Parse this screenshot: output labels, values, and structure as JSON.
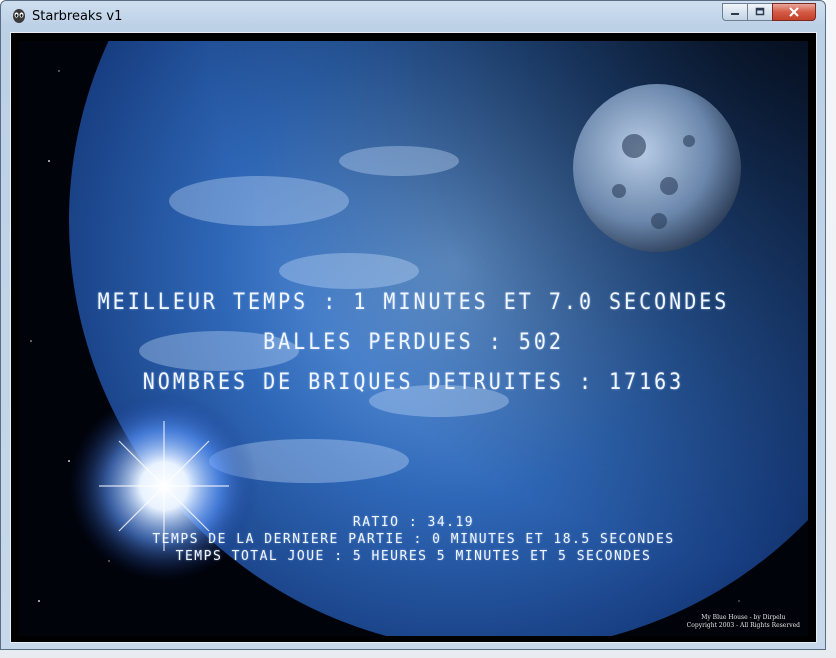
{
  "window": {
    "title": "Starbreaks v1",
    "icon": "alien-icon",
    "controls": [
      "minimize-icon",
      "maximize-icon",
      "close-icon"
    ]
  },
  "stats": {
    "best_time": "MEILLEUR TEMPS : 1 MINUTES ET 7.0 SECONDES",
    "balls_lost": "BALLES PERDUES : 502",
    "bricks_destroyed": "NOMBRES DE BRIQUES DETRUITES : 17163",
    "ratio": "RATIO : 34.19",
    "last_game_time": "TEMPS DE LA DERNIERE PARTIE : 0 MINUTES ET 18.5 SECONDES",
    "total_time": "TEMPS TOTAL JOUE : 5 HEURES 5 MINUTES ET 5 SECONDES"
  },
  "wallpaper_credit": {
    "line1": "My Blue House - by Dirpelu",
    "line2": "Copyright 2003 - All Rights Reserved"
  },
  "colors": {
    "hud_text": "#f2f6ff",
    "space": "#01030a",
    "earth": "#1d4f9a"
  }
}
